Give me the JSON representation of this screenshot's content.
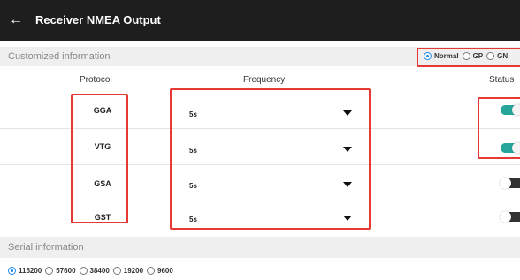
{
  "header": {
    "title": "Receiver NMEA Output",
    "back_icon": "arrow-left-icon"
  },
  "customized": {
    "label": "Customized information",
    "talker_options": [
      "Normal",
      "GP",
      "GN"
    ],
    "selected": "Normal"
  },
  "table": {
    "columns": [
      "Protocol",
      "Frequency",
      "Status"
    ],
    "rows": [
      {
        "protocol": "GGA",
        "frequency": "5s",
        "enabled": true
      },
      {
        "protocol": "VTG",
        "frequency": "5s",
        "enabled": true
      },
      {
        "protocol": "GSA",
        "frequency": "5s",
        "enabled": false
      },
      {
        "protocol": "GST",
        "frequency": "5s",
        "enabled": false
      }
    ]
  },
  "serial": {
    "label": "Serial information",
    "baud_options": [
      "115200",
      "57600",
      "38400",
      "19200",
      "9600"
    ],
    "selected": "115200"
  },
  "colors": {
    "accent": "#1e88e5",
    "toggle_on": "#26a69a",
    "highlight": "#e53935",
    "appbar": "#1e1e1e"
  }
}
